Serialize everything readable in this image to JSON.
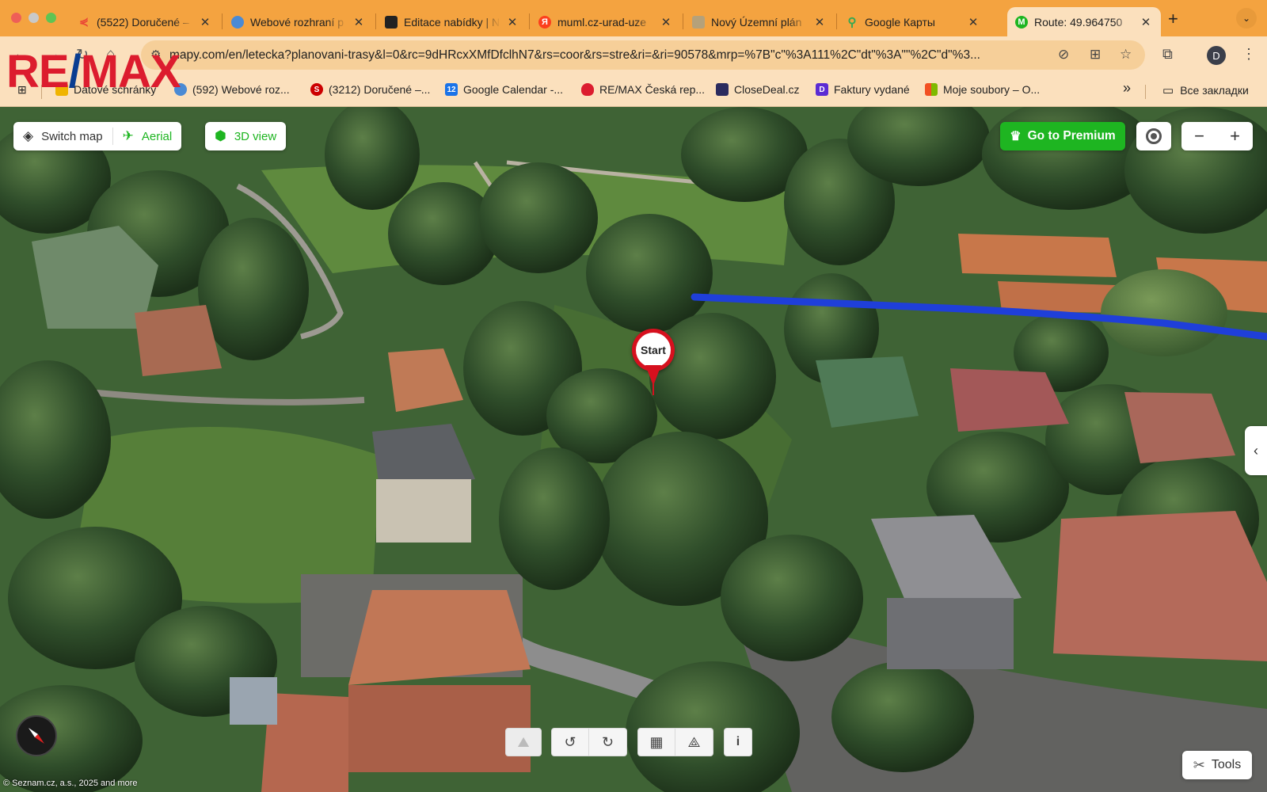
{
  "browser": {
    "tabs": [
      {
        "title": "(5522) Doručené –",
        "favicon": "envelope-icon",
        "color": "#ea4335",
        "active": false
      },
      {
        "title": "Webové rozhraní p",
        "favicon": "globe-icon",
        "color": "#4a8ad4",
        "active": false
      },
      {
        "title": "Editace nabídky | N",
        "favicon": "clapperboard-icon",
        "color": "#222222",
        "active": false
      },
      {
        "title": "muml.cz-urad-uze",
        "favicon": "yandex-icon",
        "color": "#fc3f1d",
        "active": false
      },
      {
        "title": "Nový Územní plán",
        "favicon": "document-icon",
        "color": "#b5a17a",
        "active": false
      },
      {
        "title": "Google Карты",
        "favicon": "map-pin-icon",
        "color": "#34a853",
        "active": false
      },
      {
        "title": "Route: 49.964750",
        "favicon": "mapy-icon",
        "color": "#1eb521",
        "active": true
      }
    ],
    "new_tab": "+",
    "url": "mapy.com/en/letecka?planovani-trasy&l=0&rc=9dHRcxXMfDfclhN7&rs=coor&rs=stre&ri=&ri=90578&mrp=%7B\"c\"%3A111%2C\"dt\"%3A\"\"%2C\"d\"%3...",
    "profile_initial": "D"
  },
  "bookmarks": [
    {
      "label": "Datové schránky",
      "icon": "envelope-icon",
      "color": "#f0b400"
    },
    {
      "label": "(592) Webové roz...",
      "icon": "globe-icon",
      "color": "#4a8ad4"
    },
    {
      "label": "(3212) Doručené –...",
      "icon": "seznam-icon",
      "color": "#cc0000"
    },
    {
      "label": "Google Calendar -...",
      "icon": "calendar-icon",
      "color": "#1a73e8"
    },
    {
      "label": "RE/MAX Česká rep...",
      "icon": "balloon-icon",
      "color": "#dc1c2e"
    },
    {
      "label": "CloseDeal.cz",
      "icon": "shield-icon",
      "color": "#2b2b5e"
    },
    {
      "label": "Faktury vydané",
      "icon": "d-icon",
      "color": "#5b2bd3"
    },
    {
      "label": "Moje soubory – O...",
      "icon": "microsoft-icon",
      "color": "#f25022"
    }
  ],
  "bookmarks_overflow": "»",
  "bookmarks_folder": "Все закладки",
  "logo": {
    "left": "RE",
    "slash": "/",
    "right": "MAX"
  },
  "map": {
    "switch_map": "Switch map",
    "aerial": "Aerial",
    "view_3d": "3D view",
    "premium": "Go to Premium",
    "zoom_out": "−",
    "zoom_in": "+",
    "marker_label": "Start",
    "info": "i",
    "tools": "Tools",
    "copyright": "© Seznam.cz, a.s., 2025 and more",
    "route_color": "#1f3fd9",
    "accent": "#1eb521"
  }
}
